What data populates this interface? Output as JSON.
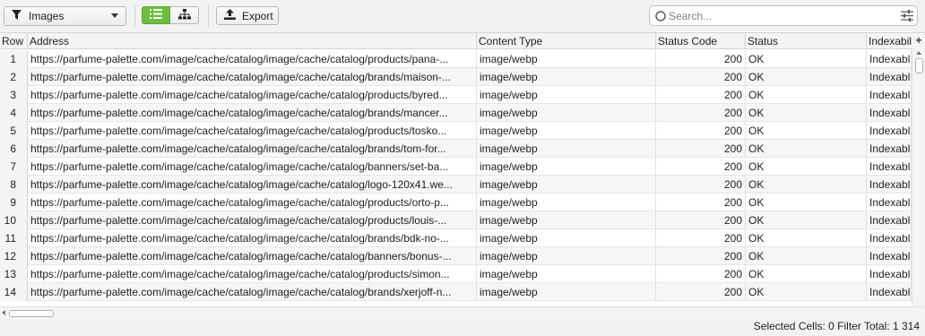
{
  "toolbar": {
    "filter": {
      "selected": "Images",
      "icon": "funnel-icon"
    },
    "view_list_icon": "list-view-icon",
    "view_tree_icon": "tree-view-icon",
    "export_label": "Export",
    "export_icon": "export-icon",
    "search_placeholder": "Search...",
    "accent_color": "#6cbf3e"
  },
  "table": {
    "columns": [
      "Row",
      "Address",
      "Content Type",
      "Status Code",
      "Status",
      "Indexabil"
    ],
    "add_column_label": "+",
    "rows": [
      {
        "row": "1",
        "address": "https://parfume-palette.com/image/cache/catalog/image/cache/catalog/products/pana-...",
        "content_type": "image/webp",
        "status_code": "200",
        "status": "OK",
        "indexability": "Indexabl"
      },
      {
        "row": "2",
        "address": "https://parfume-palette.com/image/cache/catalog/image/cache/catalog/brands/maison-...",
        "content_type": "image/webp",
        "status_code": "200",
        "status": "OK",
        "indexability": "Indexabl"
      },
      {
        "row": "3",
        "address": "https://parfume-palette.com/image/cache/catalog/image/cache/catalog/products/byred...",
        "content_type": "image/webp",
        "status_code": "200",
        "status": "OK",
        "indexability": "Indexabl"
      },
      {
        "row": "4",
        "address": "https://parfume-palette.com/image/cache/catalog/image/cache/catalog/brands/mancer...",
        "content_type": "image/webp",
        "status_code": "200",
        "status": "OK",
        "indexability": "Indexabl"
      },
      {
        "row": "5",
        "address": "https://parfume-palette.com/image/cache/catalog/image/cache/catalog/products/tosko...",
        "content_type": "image/webp",
        "status_code": "200",
        "status": "OK",
        "indexability": "Indexabl"
      },
      {
        "row": "6",
        "address": "https://parfume-palette.com/image/cache/catalog/image/cache/catalog/brands/tom-for...",
        "content_type": "image/webp",
        "status_code": "200",
        "status": "OK",
        "indexability": "Indexabl"
      },
      {
        "row": "7",
        "address": "https://parfume-palette.com/image/cache/catalog/image/cache/catalog/banners/set-ba...",
        "content_type": "image/webp",
        "status_code": "200",
        "status": "OK",
        "indexability": "Indexabl"
      },
      {
        "row": "8",
        "address": "https://parfume-palette.com/image/cache/catalog/image/cache/catalog/logo-120x41.we...",
        "content_type": "image/webp",
        "status_code": "200",
        "status": "OK",
        "indexability": "Indexabl"
      },
      {
        "row": "9",
        "address": "https://parfume-palette.com/image/cache/catalog/image/cache/catalog/products/orto-p...",
        "content_type": "image/webp",
        "status_code": "200",
        "status": "OK",
        "indexability": "Indexabl"
      },
      {
        "row": "10",
        "address": "https://parfume-palette.com/image/cache/catalog/image/cache/catalog/products/louis-...",
        "content_type": "image/webp",
        "status_code": "200",
        "status": "OK",
        "indexability": "Indexabl"
      },
      {
        "row": "11",
        "address": "https://parfume-palette.com/image/cache/catalog/image/cache/catalog/brands/bdk-no-...",
        "content_type": "image/webp",
        "status_code": "200",
        "status": "OK",
        "indexability": "Indexabl"
      },
      {
        "row": "12",
        "address": "https://parfume-palette.com/image/cache/catalog/image/cache/catalog/banners/bonus-...",
        "content_type": "image/webp",
        "status_code": "200",
        "status": "OK",
        "indexability": "Indexabl"
      },
      {
        "row": "13",
        "address": "https://parfume-palette.com/image/cache/catalog/image/cache/catalog/products/simon...",
        "content_type": "image/webp",
        "status_code": "200",
        "status": "OK",
        "indexability": "Indexabl"
      },
      {
        "row": "14",
        "address": "https://parfume-palette.com/image/cache/catalog/image/cache/catalog/brands/xerjoff-n...",
        "content_type": "image/webp",
        "status_code": "200",
        "status": "OK",
        "indexability": "Indexabl"
      }
    ]
  },
  "statusbar": {
    "selected_cells": "Selected Cells:  0  Filter Total:  1 314"
  }
}
